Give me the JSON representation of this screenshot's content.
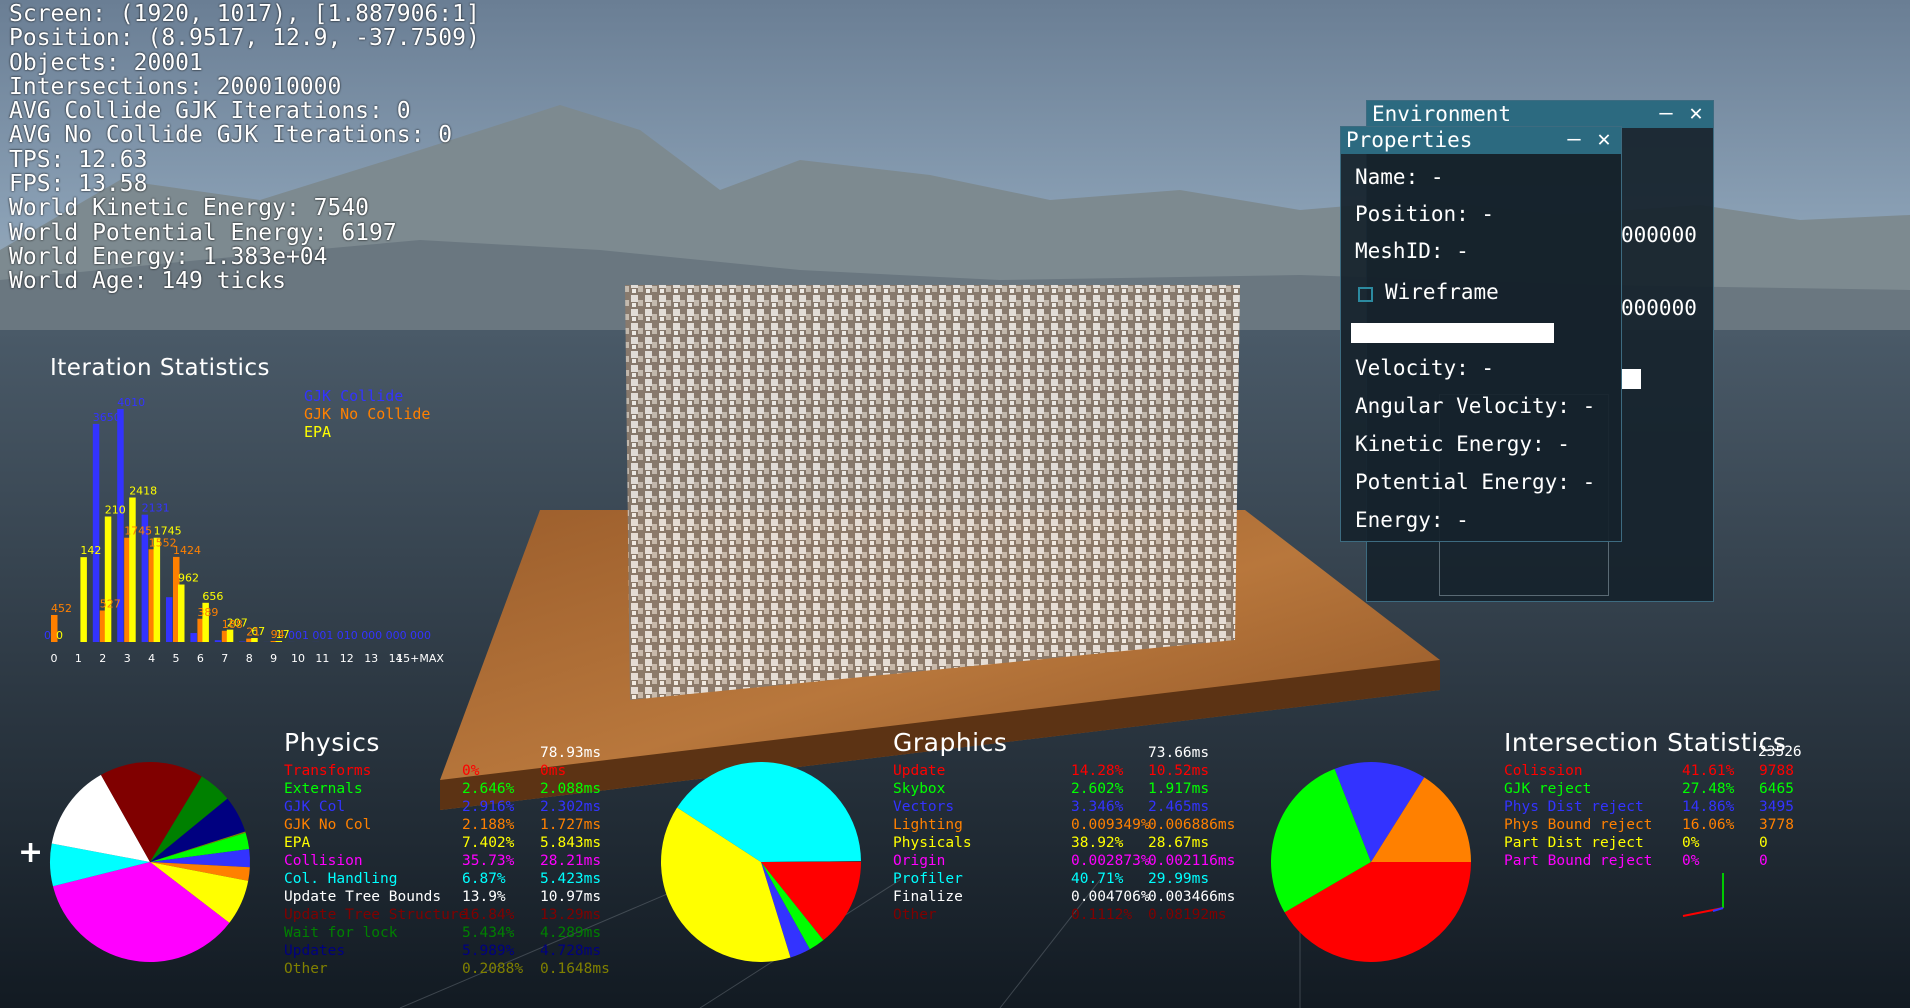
{
  "overlay": {
    "lines": [
      "Screen: (1920, 1017), [1.887906:1]",
      "Position: (8.9517, 12.9, -37.7509)",
      "Objects: 20001",
      "Intersections: 200010000",
      "AVG Collide GJK Iterations: 0",
      "AVG No Collide GJK Iterations: 0",
      "TPS: 12.63",
      "FPS: 13.58",
      "World Kinetic Energy: 7540",
      "World Potential Energy: 6197",
      "World Energy: 1.383e+04",
      "World Age: 149 ticks"
    ]
  },
  "iteration_statistics": {
    "title": "Iteration Statistics",
    "legend": [
      {
        "label": "GJK Collide",
        "color": "#3333ff"
      },
      {
        "label": "GJK No Collide",
        "color": "#ff8000"
      },
      {
        "label": "EPA",
        "color": "#ffff00"
      }
    ]
  },
  "chart_data": {
    "type": "bar",
    "categories": [
      "0",
      "1",
      "2",
      "3",
      "4",
      "5",
      "6",
      "7",
      "8",
      "9",
      "10",
      "11",
      "12",
      "13",
      "14",
      "15+MAX"
    ],
    "series": [
      {
        "name": "GJK Collide",
        "color": "#3333ff",
        "values": [
          0,
          0,
          3650,
          3900,
          2131,
          750,
          150,
          30,
          8,
          1,
          1,
          1,
          0,
          0,
          0,
          0
        ]
      },
      {
        "name": "GJK No Collide",
        "color": "#ff8000",
        "values": [
          452,
          0,
          527,
          1745,
          1552,
          1424,
          389,
          188,
          57,
          17,
          0,
          0,
          0,
          0,
          0,
          0
        ]
      },
      {
        "name": "EPA",
        "color": "#ffff00",
        "values": [
          0,
          1420,
          2100,
          2418,
          1745,
          962,
          656,
          207,
          67,
          17,
          0,
          0,
          0,
          0,
          0,
          0
        ]
      }
    ],
    "labels": [
      {
        "category": "0",
        "series": "GJK No Collide",
        "text": "452"
      },
      {
        "category": "0",
        "series": "GJK Collide",
        "text": "0"
      },
      {
        "category": "0",
        "series": "EPA",
        "text": "0"
      },
      {
        "category": "1",
        "series": "EPA",
        "text": "142"
      },
      {
        "category": "2",
        "series": "EPA",
        "text": "210"
      },
      {
        "category": "2",
        "series": "GJK Collide",
        "text": "3650"
      },
      {
        "category": "2",
        "series": "GJK No Collide",
        "text": "527"
      },
      {
        "category": "3",
        "series": "EPA",
        "text": "2418"
      },
      {
        "category": "3",
        "series": "GJK Collide",
        "text": "4010"
      },
      {
        "category": "3",
        "series": "GJK No Collide",
        "text": "1745"
      },
      {
        "category": "4",
        "series": "GJK Collide",
        "text": "2131"
      },
      {
        "category": "4",
        "series": "EPA",
        "text": "1745"
      },
      {
        "category": "4",
        "series": "GJK No Collide",
        "text": "1552"
      },
      {
        "category": "5",
        "series": "GJK No Collide",
        "text": "1424"
      },
      {
        "category": "5",
        "series": "EPA",
        "text": "962"
      },
      {
        "category": "6",
        "series": "EPA",
        "text": "656"
      },
      {
        "category": "6",
        "series": "GJK No Collide",
        "text": "389"
      },
      {
        "category": "7",
        "series": "EPA",
        "text": "207"
      },
      {
        "category": "7",
        "series": "GJK No Collide",
        "text": "188"
      },
      {
        "category": "8",
        "series": "EPA",
        "text": "67"
      },
      {
        "category": "8",
        "series": "GJK No Collide",
        "text": "21"
      },
      {
        "category": "9",
        "series": "EPA",
        "text": "17"
      },
      {
        "category": "9",
        "series": "GJK No Collide",
        "text": "94"
      },
      {
        "category": "10",
        "series": "GJK Collide",
        "text": "001"
      },
      {
        "category": "11",
        "series": "GJK Collide",
        "text": "001"
      },
      {
        "category": "12",
        "series": "GJK Collide",
        "text": "010"
      },
      {
        "category": "13",
        "series": "GJK Collide",
        "text": "000"
      },
      {
        "category": "14",
        "series": "GJK Collide",
        "text": "000"
      },
      {
        "category": "15+MAX",
        "series": "GJK Collide",
        "text": "000"
      }
    ]
  },
  "physics": {
    "title": "Physics",
    "total": "78.93ms",
    "rows": [
      {
        "label": "Transforms",
        "pct": "0%",
        "ms": "0ms",
        "color": "#ff0000",
        "value": 0
      },
      {
        "label": "Externals",
        "pct": "2.646%",
        "ms": "2.088ms",
        "color": "#00ff00",
        "value": 2.646
      },
      {
        "label": "GJK Col",
        "pct": "2.916%",
        "ms": "2.302ms",
        "color": "#3333ff",
        "value": 2.916
      },
      {
        "label": "GJK No Col",
        "pct": "2.188%",
        "ms": "1.727ms",
        "color": "#ff8000",
        "value": 2.188
      },
      {
        "label": "EPA",
        "pct": "7.402%",
        "ms": "5.843ms",
        "color": "#ffff00",
        "value": 7.402
      },
      {
        "label": "Collision",
        "pct": "35.73%",
        "ms": "28.21ms",
        "color": "#ff00ff",
        "value": 35.73
      },
      {
        "label": "Col. Handling",
        "pct": "6.87%",
        "ms": "5.423ms",
        "color": "#00ffff",
        "value": 6.87
      },
      {
        "label": "Update Tree Bounds",
        "pct": "13.9%",
        "ms": "10.97ms",
        "color": "#ffffff",
        "value": 13.9
      },
      {
        "label": "Update Tree Structure",
        "pct": "16.84%",
        "ms": "13.29ms",
        "color": "#800000",
        "value": 16.84
      },
      {
        "label": "Wait for lock",
        "pct": "5.434%",
        "ms": "4.289ms",
        "color": "#008000",
        "value": 5.434
      },
      {
        "label": "Updates",
        "pct": "5.989%",
        "ms": "4.728ms",
        "color": "#000080",
        "value": 5.989
      },
      {
        "label": "Other",
        "pct": "0.2088%",
        "ms": "0.1648ms",
        "color": "#808000",
        "value": 0.2088
      }
    ]
  },
  "graphics": {
    "title": "Graphics",
    "total": "73.66ms",
    "rows": [
      {
        "label": "Update",
        "pct": "14.28%",
        "ms": "10.52ms",
        "color": "#ff0000",
        "value": 14.28
      },
      {
        "label": "Skybox",
        "pct": "2.602%",
        "ms": "1.917ms",
        "color": "#00ff00",
        "value": 2.602
      },
      {
        "label": "Vectors",
        "pct": "3.346%",
        "ms": "2.465ms",
        "color": "#3333ff",
        "value": 3.346
      },
      {
        "label": "Lighting",
        "pct": "0.009349%",
        "ms": "0.006886ms",
        "color": "#ff8000",
        "value": 0.009349
      },
      {
        "label": "Physicals",
        "pct": "38.92%",
        "ms": "28.67ms",
        "color": "#ffff00",
        "value": 38.92
      },
      {
        "label": "Origin",
        "pct": "0.002873%",
        "ms": "0.002116ms",
        "color": "#ff00ff",
        "value": 0.002873
      },
      {
        "label": "Profiler",
        "pct": "40.71%",
        "ms": "29.99ms",
        "color": "#00ffff",
        "value": 40.71
      },
      {
        "label": "Finalize",
        "pct": "0.004706%",
        "ms": "0.003466ms",
        "color": "#ffffff",
        "value": 0.004706
      },
      {
        "label": "Other",
        "pct": "0.1112%",
        "ms": "0.08192ms",
        "color": "#800000",
        "value": 0.1112
      }
    ]
  },
  "intersection": {
    "title": "Intersection Statistics",
    "total": "23526",
    "rows": [
      {
        "label": "Colission",
        "pct": "41.61%",
        "count": "9788",
        "color": "#ff0000",
        "value": 41.61
      },
      {
        "label": "GJK reject",
        "pct": "27.48%",
        "count": "6465",
        "color": "#00ff00",
        "value": 27.48
      },
      {
        "label": "Phys Dist reject",
        "pct": "14.86%",
        "count": "3495",
        "color": "#3333ff",
        "value": 14.86
      },
      {
        "label": "Phys Bound reject",
        "pct": "16.06%",
        "count": "3778",
        "color": "#ff8000",
        "value": 16.06
      },
      {
        "label": "Part Dist reject",
        "pct": "0%",
        "count": "0",
        "color": "#ffff00",
        "value": 0
      },
      {
        "label": "Part Bound reject",
        "pct": "0%",
        "count": "0",
        "color": "#ff00ff",
        "value": 0
      }
    ]
  },
  "environment_window": {
    "title": "Environment",
    "value_1": "000000",
    "value_2": "000000"
  },
  "properties_window": {
    "title": "Properties",
    "name": "Name: -",
    "position": "Position: -",
    "mesh_id": "MeshID: -",
    "wireframe_label": "Wireframe",
    "wireframe_checked": false,
    "velocity": "Velocity: -",
    "angular_velocity": "Angular Velocity: -",
    "kinetic_energy": "Kinetic Energy: -",
    "potential_energy": "Potential Energy: -",
    "energy": "Energy: -"
  },
  "cursor": {
    "icon": "crosshair-icon",
    "glyph": "+"
  }
}
